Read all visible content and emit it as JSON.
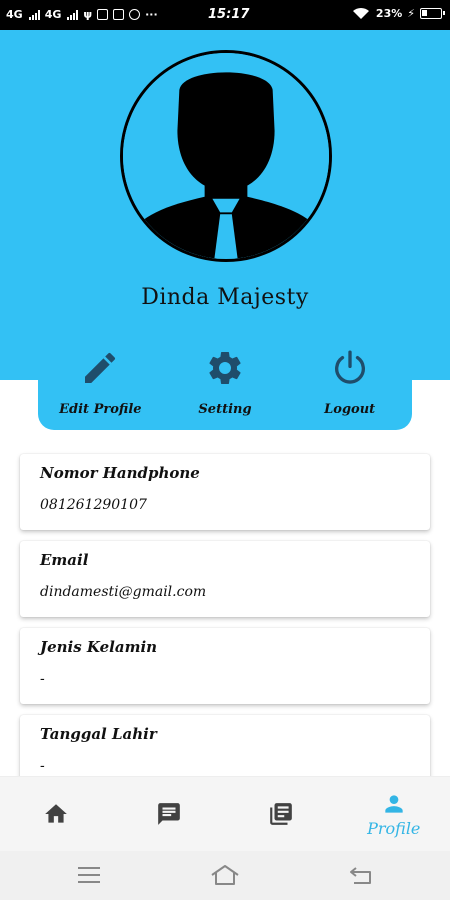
{
  "status_bar": {
    "network1": "4G",
    "network2": "4G",
    "more": "···",
    "time": "15:17",
    "battery": "23%"
  },
  "profile": {
    "name": "Dinda Majesty"
  },
  "actions": [
    {
      "label": "Edit Profile",
      "icon": "pencil-icon"
    },
    {
      "label": "Setting",
      "icon": "gear-icon"
    },
    {
      "label": "Logout",
      "icon": "power-icon"
    }
  ],
  "info": [
    {
      "label": "Nomor Handphone",
      "value": "081261290107"
    },
    {
      "label": "Email",
      "value": "dindamesti@gmail.com"
    },
    {
      "label": "Jenis Kelamin",
      "value": "-"
    },
    {
      "label": "Tanggal Lahir",
      "value": "-"
    }
  ],
  "bottom_nav": {
    "active_label": "Profile",
    "items": [
      "home-icon",
      "chat-icon",
      "news-icon",
      "person-icon"
    ]
  },
  "colors": {
    "accent": "#33c1f4",
    "icon_dark": "#1f4d6b",
    "nav_active": "#33b5e5"
  }
}
